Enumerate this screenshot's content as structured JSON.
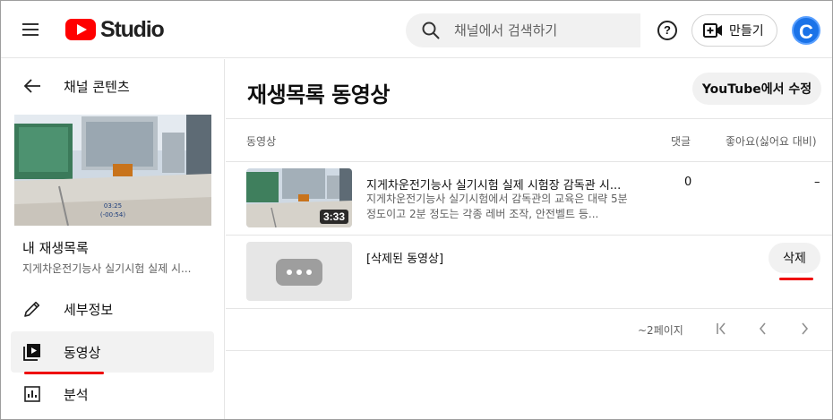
{
  "header": {
    "logo_text": "Studio",
    "search_placeholder": "채널에서 검색하기",
    "help_label": "?",
    "create_label": "만들기",
    "avatar_letter": "C"
  },
  "sidebar": {
    "back_label": "채널 콘텐츠",
    "thumbnail_overlay": [
      "03:25",
      "(-00:54)"
    ],
    "playlist_title": "내 재생목록",
    "playlist_subtitle": "지게차운전기능사 실기시험 실제 시...",
    "nav": [
      {
        "label": "세부정보",
        "icon": "pencil-icon"
      },
      {
        "label": "동영상",
        "icon": "video-playlist-icon",
        "active": true
      },
      {
        "label": "분석",
        "icon": "analytics-icon"
      }
    ]
  },
  "main": {
    "page_title": "재생목록 동영상",
    "edit_button": "YouTube에서 수정",
    "columns": {
      "video": "동영상",
      "comments": "댓글",
      "likes": "좋아요(싫어요 대비)"
    },
    "videos": [
      {
        "title": "지게차운전기능사 실기시험 실제 시험장 감독관 시...",
        "description": "지게차운전기능사 실기시험에서 감독관의 교육은 대략 5분 정도이고 2분 정도는 각종 레버 조작, 안전벨트 등...",
        "duration": "3:33",
        "comments": "0",
        "likes": "–"
      }
    ],
    "deleted_video": {
      "title": "[삭제된 동영상]",
      "delete_label": "삭제"
    },
    "pagination": {
      "label": "~2페이지"
    }
  },
  "colors": {
    "brand_red": "#ff0000",
    "accent_blue": "#1b73e8",
    "highlight_underline": "#ee0000"
  }
}
